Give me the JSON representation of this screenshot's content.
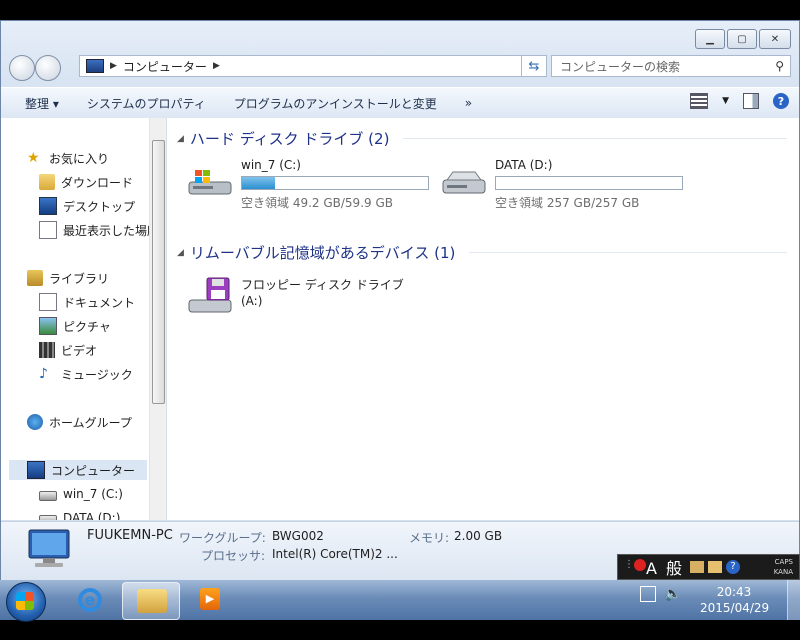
{
  "window": {
    "address_path": "コンピューター",
    "search_placeholder": "コンピューターの検索"
  },
  "toolbar": {
    "organize": "整理",
    "system_properties": "システムのプロパティ",
    "uninstall": "プログラムのアンインストールと変更",
    "more": "»"
  },
  "nav": {
    "favorites": "お気に入り",
    "downloads": "ダウンロード",
    "desktop": "デスクトップ",
    "recent": "最近表示した場所",
    "libraries": "ライブラリ",
    "documents": "ドキュメント",
    "pictures": "ピクチャ",
    "videos": "ビデオ",
    "music": "ミュージック",
    "homegroup": "ホームグループ",
    "computer": "コンピューター",
    "drive_c": "win_7 (C:)",
    "drive_d": "DATA (D:)"
  },
  "groups": {
    "hdd": "ハード ディスク ドライブ (2)",
    "removable": "リムーバブル記憶域があるデバイス (1)"
  },
  "drives": {
    "c": {
      "name": "win_7 (C:)",
      "free": "空き領域 49.2 GB/59.9 GB",
      "used_fraction": 0.18
    },
    "d": {
      "name": "DATA (D:)",
      "free": "空き領域 257 GB/257 GB",
      "used_fraction": 0.0
    },
    "floppy": {
      "name_line1": "フロッピー ディスク ドライブ",
      "name_line2": "(A:)"
    }
  },
  "details": {
    "pc_name": "FUUKEMN-PC",
    "workgroup_label": "ワークグループ:",
    "workgroup_value": "BWG002",
    "memory_label": "メモリ:",
    "memory_value": "2.00 GB",
    "processor_label": "プロセッサ:",
    "processor_value": "Intel(R) Core(TM)2 ..."
  },
  "ime": {
    "mode": "A 般",
    "caps": "CAPS",
    "kana": "KANA"
  },
  "clock": {
    "time": "20:43",
    "date": "2015/04/29"
  }
}
